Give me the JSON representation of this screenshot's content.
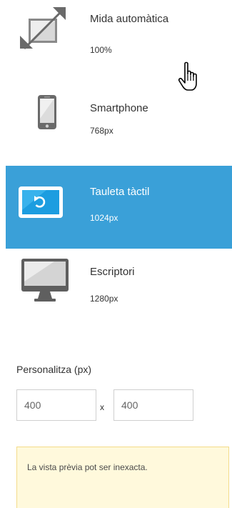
{
  "devices": [
    {
      "id": "auto",
      "label": "Mida automàtica",
      "size": "100%",
      "icon": "auto-size-icon",
      "selected": false
    },
    {
      "id": "phone",
      "label": "Smartphone",
      "size": "768px",
      "icon": "smartphone-icon",
      "selected": false
    },
    {
      "id": "tablet",
      "label": "Tauleta tàctil",
      "size": "1024px",
      "icon": "tablet-icon",
      "selected": true
    },
    {
      "id": "desktop",
      "label": "Escriptori",
      "size": "1280px",
      "icon": "desktop-icon",
      "selected": false
    }
  ],
  "custom": {
    "label": "Personalitza (px)",
    "width_value": "400",
    "height_value": "400",
    "separator": "x"
  },
  "warning": {
    "text": "La vista prèvia pot ser inexacta."
  },
  "colors": {
    "selected_bg": "#3aa0d8",
    "warning_bg": "#fff9dc",
    "warning_border": "#f3dc8a",
    "icon_gray": "#5f5f5f"
  },
  "cursor_icon": "hand-pointer-icon"
}
